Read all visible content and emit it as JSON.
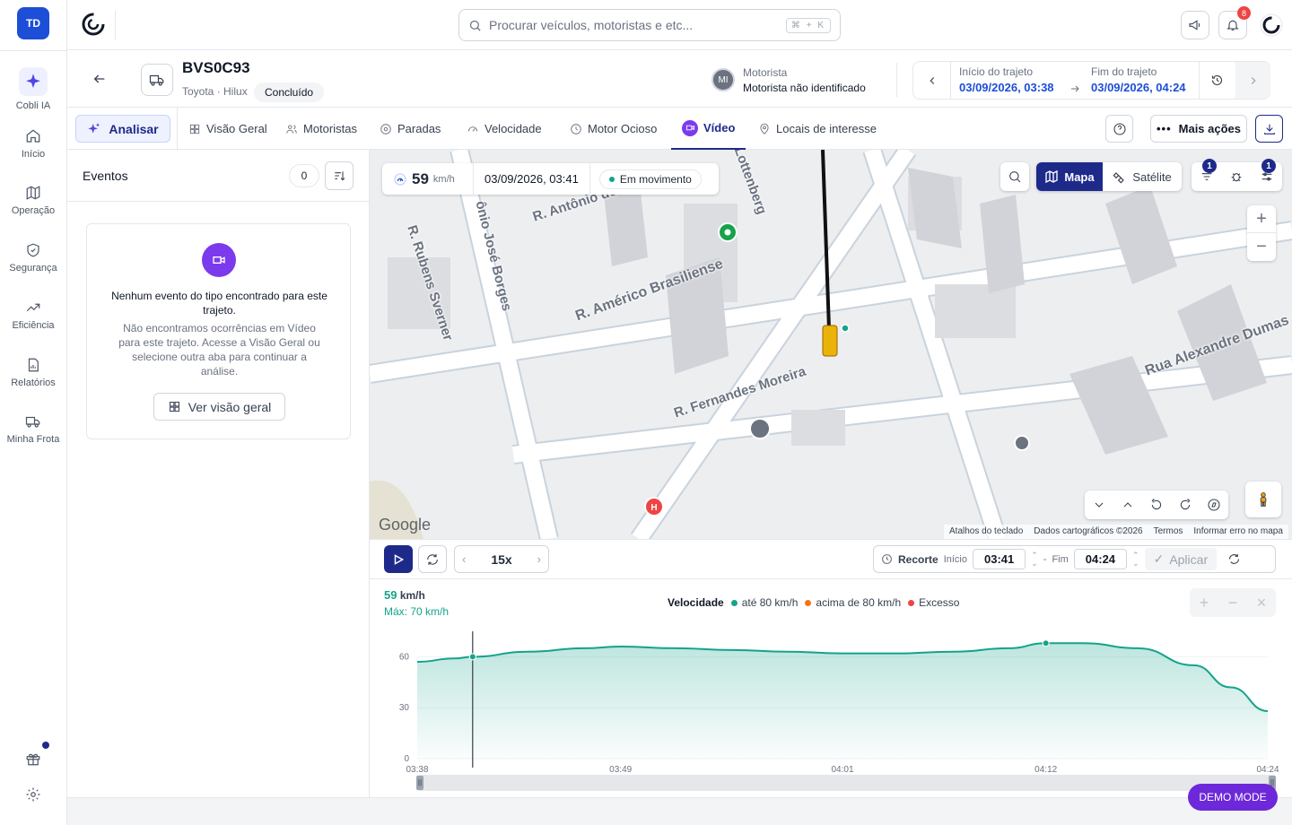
{
  "sidebar": {
    "avatar": "TD",
    "items": [
      {
        "label": "Cobli IA",
        "icon": "sparkles-icon"
      },
      {
        "label": "Início",
        "icon": "home-icon"
      },
      {
        "label": "Operação",
        "icon": "map-icon"
      },
      {
        "label": "Segurança",
        "icon": "shield-icon"
      },
      {
        "label": "Eficiência",
        "icon": "trending-up-icon"
      },
      {
        "label": "Relatórios",
        "icon": "report-icon"
      },
      {
        "label": "Minha Frota",
        "icon": "truck-icon"
      }
    ]
  },
  "topbar": {
    "search_placeholder": "Procurar veículos, motoristas e etc...",
    "shortcut": "⌘ + K",
    "notification_count": "8"
  },
  "vehicle": {
    "plate": "BVS0C93",
    "model": "Toyota · Hilux",
    "status": "Concluído",
    "driver_initials": "MI",
    "driver_label": "Motorista",
    "driver_name": "Motorista não identificado",
    "trip_start_label": "Início do trajeto",
    "trip_start": "03/09/2026, 03:38",
    "trip_end_label": "Fim do trajeto",
    "trip_end": "03/09/2026, 04:24"
  },
  "tabs": {
    "analyze": "Analisar",
    "items": [
      "Visão Geral",
      "Motoristas",
      "Paradas",
      "Velocidade",
      "Motor Ocioso",
      "Vídeo",
      "Locais de interesse"
    ],
    "active": "Vídeo",
    "more_actions": "Mais ações"
  },
  "events": {
    "title": "Eventos",
    "count": "0",
    "empty_title": "Nenhum evento do tipo encontrado para este trajeto.",
    "empty_body": "Não encontramos ocorrências em Vídeo para este trajeto. Acesse a Visão Geral ou selecione outra aba para continuar a análise.",
    "overview_button": "Ver visão geral"
  },
  "map": {
    "speed": "59",
    "speed_unit": "km/h",
    "timestamp": "03/09/2026, 03:41",
    "status": "Em movimento",
    "map_button": "Mapa",
    "satellite_button": "Satélite",
    "filter_badge": "1",
    "settings_badge": "1",
    "streets": [
      "R. Antônio de",
      "ônio José Borges",
      "R. Rubens Sverner",
      "R. Américo Brasiliense",
      "R. Fernandes Moreira",
      "Rua Alexandre Dumas",
      "Lottenberg"
    ],
    "google": "Google",
    "attribution": [
      "Atalhos do teclado",
      "Dados cartográficos ©2026",
      "Termos",
      "Informar erro no mapa"
    ]
  },
  "player": {
    "speed_multiplier": "15x",
    "clip_label": "Recorte",
    "start_label": "Início",
    "start_time": "03:41",
    "end_label": "Fim",
    "end_time": "04:24",
    "apply": "Aplicar"
  },
  "chart_header": {
    "current_speed": "59",
    "unit": "km/h",
    "max": "Máx: 70 km/h",
    "legend_title": "Velocidade",
    "legend": [
      {
        "label": "até 80 km/h",
        "color": "#14a38b"
      },
      {
        "label": "acima de 80 km/h",
        "color": "#f97316"
      },
      {
        "label": "Excesso",
        "color": "#ef4444"
      }
    ]
  },
  "chart_data": {
    "type": "area",
    "x": [
      "03:38",
      "03:40",
      "03:41",
      "03:44",
      "03:47",
      "03:49",
      "03:52",
      "03:55",
      "03:58",
      "04:01",
      "04:04",
      "04:07",
      "04:10",
      "04:12",
      "04:14",
      "04:17",
      "04:20",
      "04:22",
      "04:24"
    ],
    "values": [
      57,
      59,
      60,
      63,
      65,
      66,
      65,
      64,
      63,
      62,
      62,
      63,
      65,
      68,
      68,
      65,
      55,
      42,
      28
    ],
    "xticks": [
      "03:38",
      "03:49",
      "04:01",
      "04:12",
      "04:24"
    ],
    "yticks": [
      0,
      30,
      60
    ],
    "ylim": [
      0,
      75
    ],
    "cursor_x": "03:41",
    "max_point_x": "04:12",
    "color": "#14a38b"
  },
  "demo_mode": "DEMO MODE",
  "colors": {
    "primary": "#1e2a8a",
    "accent": "#6d28d9",
    "teal": "#14a38b"
  }
}
